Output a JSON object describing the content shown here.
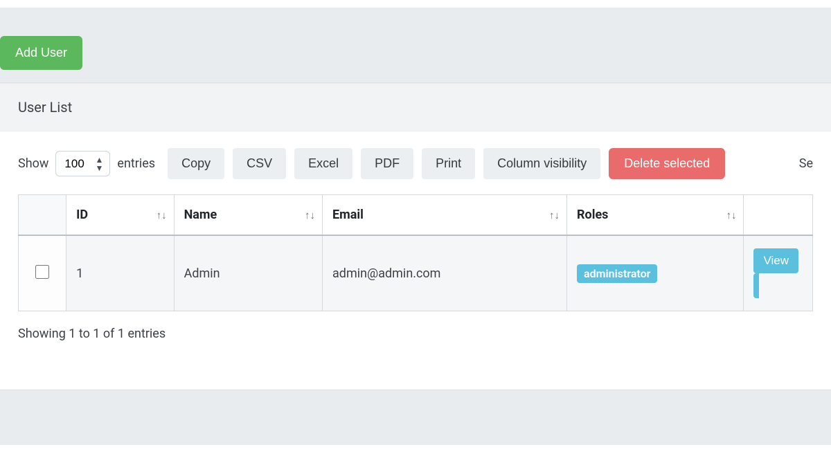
{
  "actions": {
    "add_user": "Add User"
  },
  "card": {
    "title": "User List"
  },
  "length": {
    "show": "Show",
    "entries": "entries",
    "value": "100"
  },
  "buttons": {
    "copy": "Copy",
    "csv": "CSV",
    "excel": "Excel",
    "pdf": "PDF",
    "print": "Print",
    "colvis": "Column visibility",
    "delete_selected": "Delete selected"
  },
  "search": {
    "label_partial": "Se"
  },
  "table": {
    "headers": {
      "id": "ID",
      "name": "Name",
      "email": "Email",
      "roles": "Roles"
    },
    "rows": [
      {
        "id": "1",
        "name": "Admin",
        "email": "admin@admin.com",
        "role_badge": "administrator",
        "view": "View"
      }
    ]
  },
  "info": "Showing 1 to 1 of 1 entries"
}
